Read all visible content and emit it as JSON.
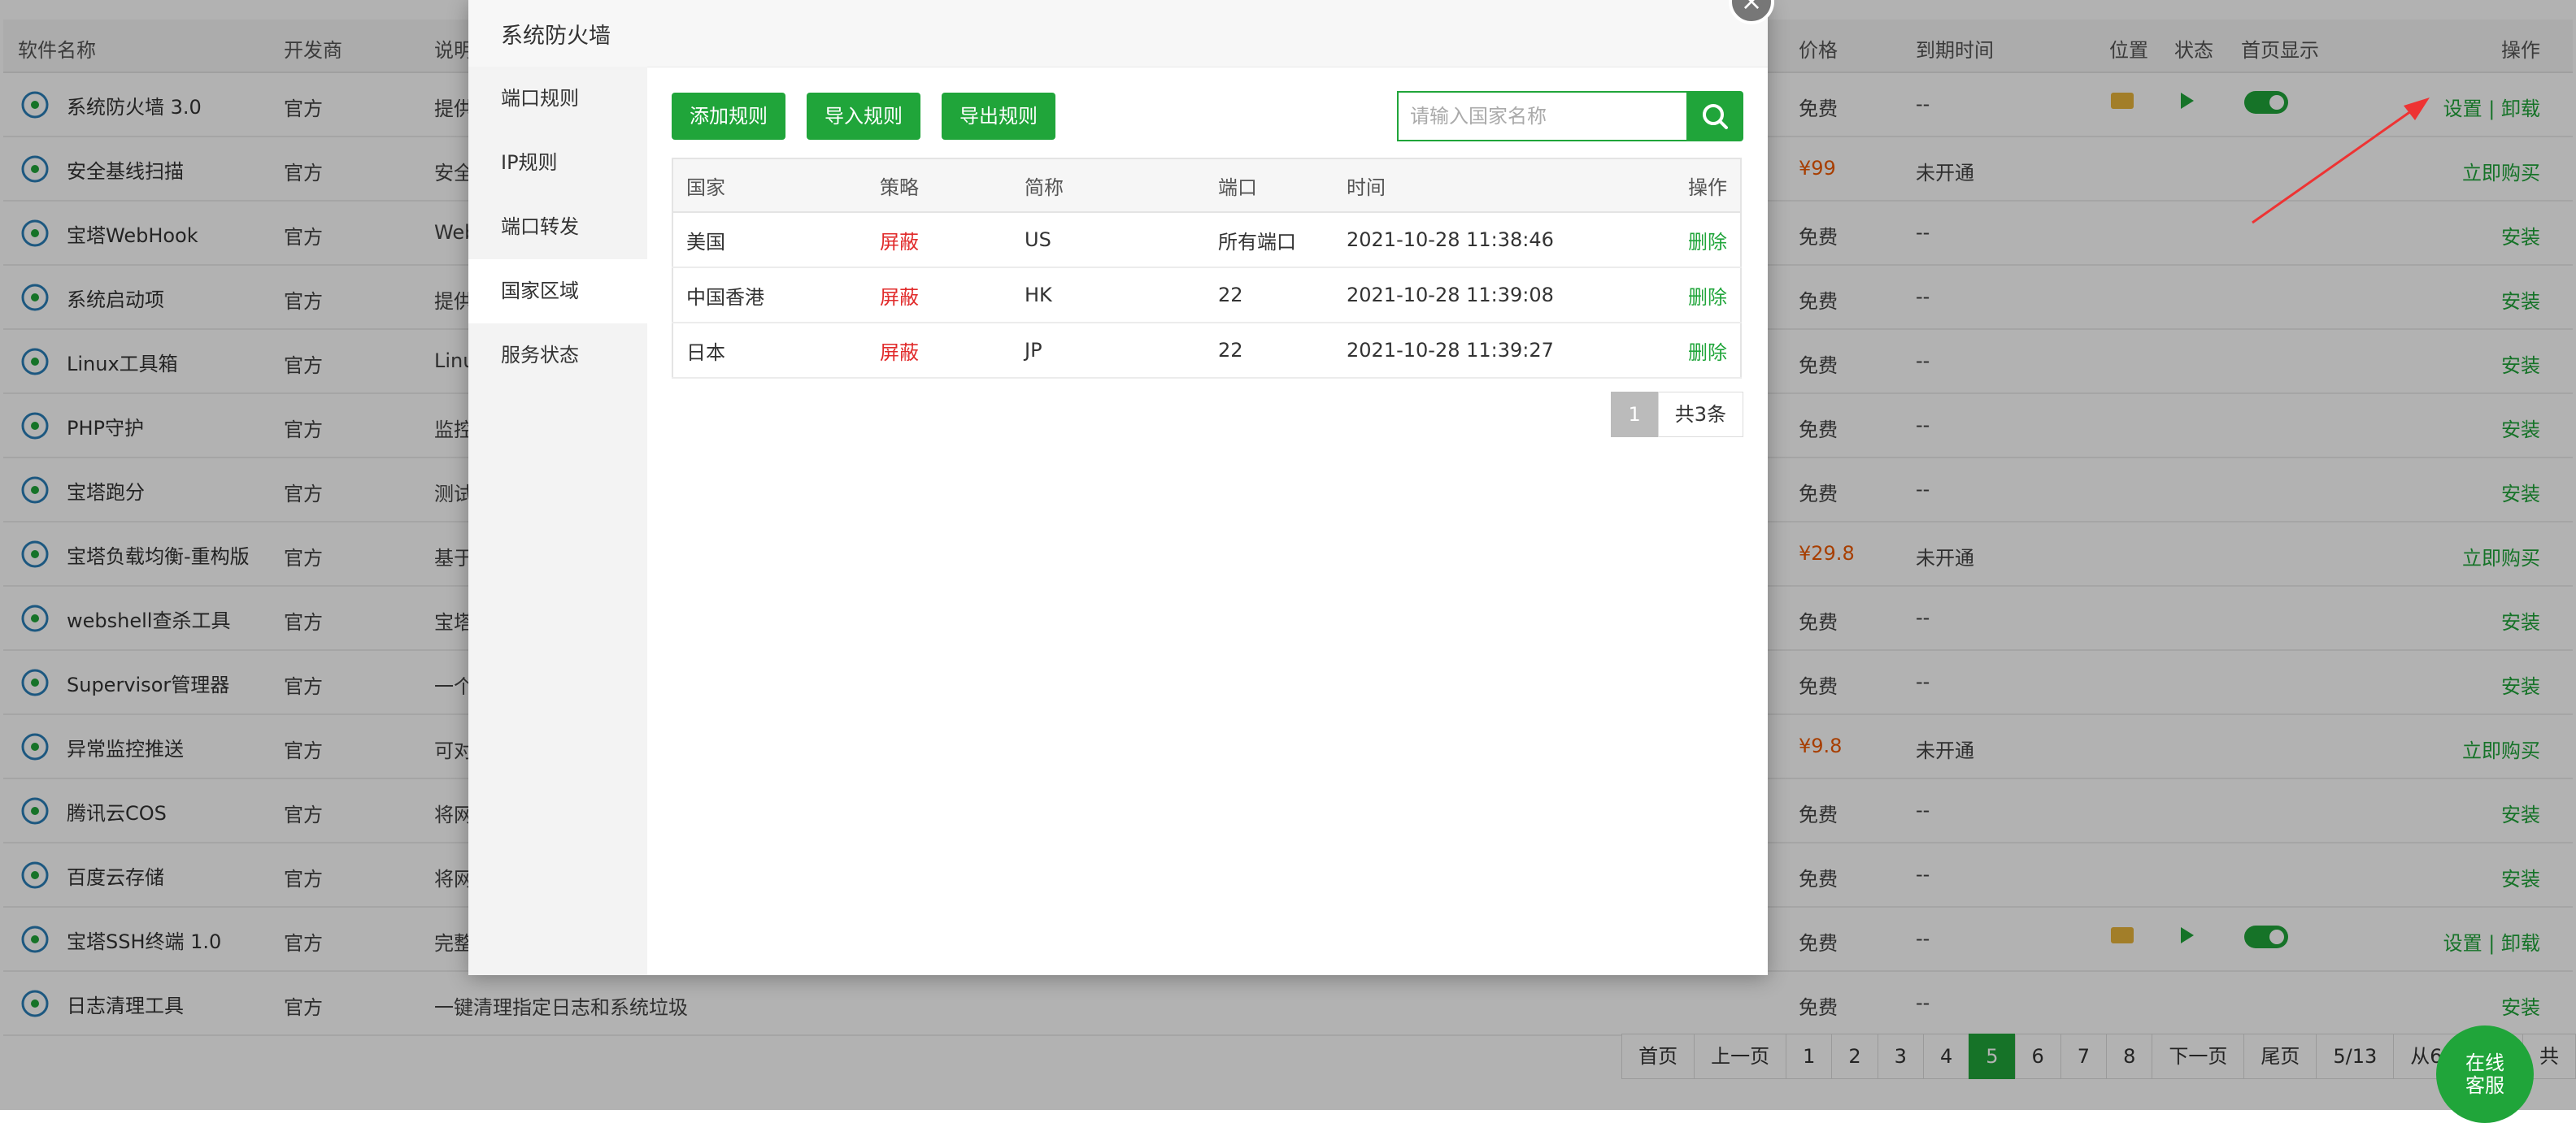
{
  "background_table": {
    "headers": {
      "name": "软件名称",
      "developer": "开发商",
      "description": "说明",
      "price": "价格",
      "expiry": "到期时间",
      "location": "位置",
      "status": "状态",
      "homepage": "首页显示",
      "operation": "操作"
    },
    "rows": [
      {
        "name": "系统防火墙 3.0",
        "dev": "官方",
        "desc": "提供",
        "price": "免费",
        "exp": "--",
        "op": "设置 | 卸载",
        "icon": "shield-icon",
        "installed": true
      },
      {
        "name": "安全基线扫描",
        "dev": "官方",
        "desc": "安全",
        "price": "¥99",
        "exp": "未开通",
        "op": "立即购买",
        "icon": "scan-shield-icon",
        "paid": true
      },
      {
        "name": "宝塔WebHook",
        "dev": "官方",
        "desc": "Web",
        "price": "免费",
        "exp": "--",
        "op": "安装",
        "icon": "anchor-icon"
      },
      {
        "name": "系统启动项",
        "dev": "官方",
        "desc": "提供",
        "price": "免费",
        "exp": "--",
        "op": "安装",
        "icon": "play-circle-icon"
      },
      {
        "name": "Linux工具箱",
        "dev": "官方",
        "desc": "Linu",
        "price": "免费",
        "exp": "--",
        "op": "安装",
        "icon": "tools-icon"
      },
      {
        "name": "PHP守护",
        "dev": "官方",
        "desc": "监控",
        "price": "免费",
        "exp": "--",
        "op": "安装",
        "icon": "php-shield-icon"
      },
      {
        "name": "宝塔跑分",
        "dev": "官方",
        "desc": "测试",
        "price": "免费",
        "exp": "--",
        "op": "安装",
        "icon": "gauge-icon"
      },
      {
        "name": "宝塔负载均衡-重构版",
        "dev": "官方",
        "desc": "基于",
        "price": "¥29.8",
        "exp": "未开通",
        "op": "立即购买",
        "icon": "network-icon",
        "paid": true
      },
      {
        "name": "webshell查杀工具",
        "dev": "官方",
        "desc": "宝塔",
        "price": "免费",
        "exp": "--",
        "op": "安装",
        "icon": "shield-scan-icon"
      },
      {
        "name": "Supervisor管理器",
        "dev": "官方",
        "desc": "一个",
        "price": "免费",
        "exp": "--",
        "op": "安装",
        "icon": "penguin-icon"
      },
      {
        "name": "异常监控推送",
        "dev": "官方",
        "desc": "可对",
        "price": "¥9.8",
        "exp": "未开通",
        "op": "立即购买",
        "icon": "send-icon",
        "paid": true
      },
      {
        "name": "腾讯云COS",
        "dev": "官方",
        "desc": "将网",
        "price": "免费",
        "exp": "--",
        "op": "安装",
        "icon": "cloud-icon"
      },
      {
        "name": "百度云存储",
        "dev": "官方",
        "desc": "将网",
        "price": "免费",
        "exp": "--",
        "op": "安装",
        "icon": "cube-icon"
      },
      {
        "name": "宝塔SSH终端 1.0",
        "dev": "官方",
        "desc": "完整",
        "price": "免费",
        "exp": "--",
        "op": "设置 | 卸载",
        "icon": "terminal-icon",
        "installed": true
      },
      {
        "name": "日志清理工具",
        "dev": "官方",
        "desc": "一键清理指定日志和系统垃圾",
        "price": "免费",
        "exp": "--",
        "op": "安装",
        "icon": "broom-icon"
      }
    ],
    "pagination": [
      "首页",
      "上一页",
      "1",
      "2",
      "3",
      "4",
      "5",
      "6",
      "7",
      "8",
      "下一页",
      "尾页",
      "5/13",
      "从61-75条",
      "共"
    ],
    "current_page": "5"
  },
  "modal": {
    "title": "系统防火墙",
    "close": "×",
    "sidebar": [
      "端口规则",
      "IP规则",
      "端口转发",
      "国家区域",
      "服务状态"
    ],
    "active_tab": "国家区域",
    "buttons": {
      "add": "添加规则",
      "import": "导入规则",
      "export": "导出规则"
    },
    "search_placeholder": "请输入国家名称",
    "table": {
      "headers": [
        "国家",
        "策略",
        "简称",
        "端口",
        "时间",
        "操作"
      ],
      "rows": [
        {
          "country": "美国",
          "strategy": "屏蔽",
          "code": "US",
          "port": "所有端口",
          "time": "2021-10-28 11:38:46",
          "op": "删除"
        },
        {
          "country": "中国香港",
          "strategy": "屏蔽",
          "code": "HK",
          "port": "22",
          "time": "2021-10-28 11:39:08",
          "op": "删除"
        },
        {
          "country": "日本",
          "strategy": "屏蔽",
          "code": "JP",
          "port": "22",
          "time": "2021-10-28 11:39:27",
          "op": "删除"
        }
      ]
    },
    "pager": {
      "page": "1",
      "total": "共3条"
    }
  },
  "chat": {
    "line1": "在线",
    "line2": "客服"
  },
  "colors": {
    "accent": "#20a53a",
    "danger": "#e12b2b",
    "price": "#f05a00"
  }
}
